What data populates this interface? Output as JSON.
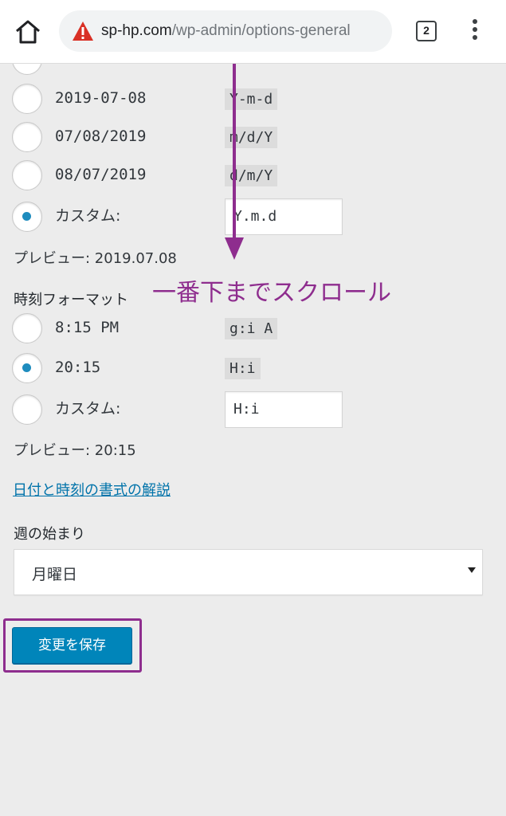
{
  "browser": {
    "url_host": "sp-hp.com",
    "url_path": "/wp-admin/options-general",
    "tab_count": "2",
    "warning_icon": "warning-triangle-icon",
    "home_icon": "home-icon",
    "menu_icon": "overflow-menu-icon"
  },
  "date_format": {
    "options": [
      {
        "label": "2019-07-08",
        "code": "Y-m-d",
        "checked": false
      },
      {
        "label": "07/08/2019",
        "code": "m/d/Y",
        "checked": false
      },
      {
        "label": "08/07/2019",
        "code": "d/m/Y",
        "checked": false
      }
    ],
    "custom_label": "カスタム:",
    "custom_value": "Y.m.d",
    "custom_checked": true,
    "preview": "プレビュー: 2019.07.08"
  },
  "time_format": {
    "title": "時刻フォーマット",
    "options": [
      {
        "label": "8:15 PM",
        "code": "g:i A",
        "checked": false
      },
      {
        "label": "20:15",
        "code": "H:i",
        "checked": true
      }
    ],
    "custom_label": "カスタム:",
    "custom_value": "H:i",
    "custom_checked": false,
    "preview": "プレビュー: 20:15"
  },
  "help_link": "日付と時刻の書式の解説",
  "week_start": {
    "title": "週の始まり",
    "selected": "月曜日"
  },
  "save_button": "変更を保存",
  "annotation": {
    "text": "一番下までスクロール",
    "color": "#8e2d8e"
  },
  "colors": {
    "accent": "#0085ba",
    "link": "#0073aa",
    "radio_checked": "#1e8cbe",
    "annotation": "#8e2d8e"
  }
}
